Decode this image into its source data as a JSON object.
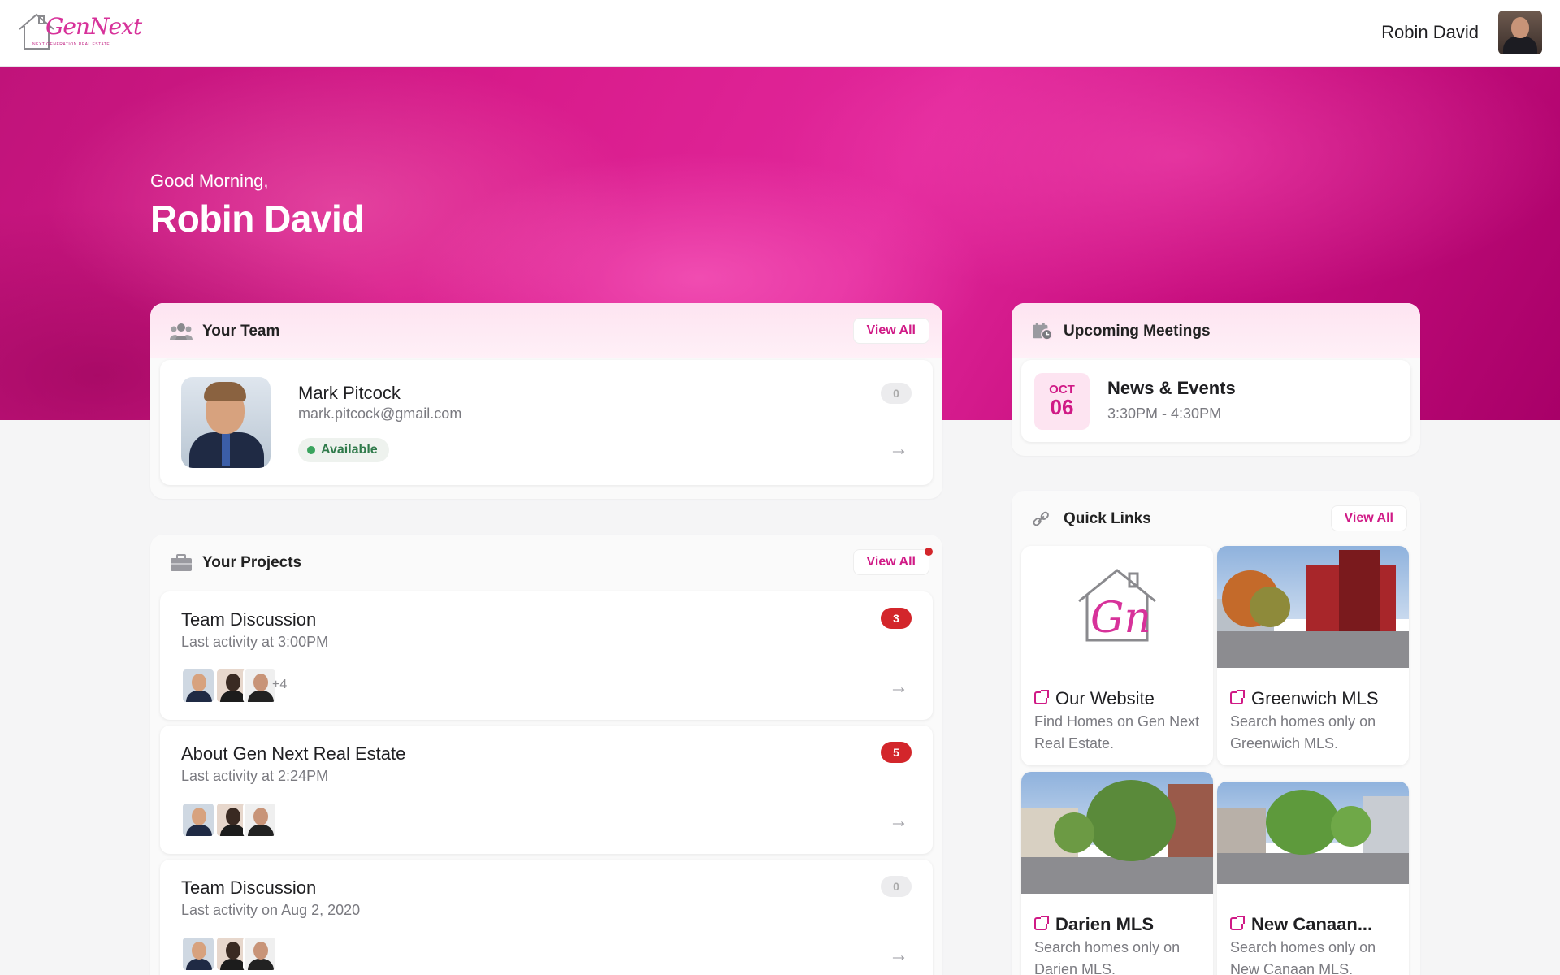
{
  "header": {
    "logo_text": "GenNext",
    "logo_tagline": "NEXT GENERATION REAL ESTATE",
    "user_name": "Robin David"
  },
  "hero": {
    "greeting": "Good Morning,",
    "name": "Robin David"
  },
  "team": {
    "title": "Your Team",
    "view_all": "View All",
    "icon": "people-icon",
    "member": {
      "name": "Mark Pitcock",
      "email": "mark.pitcock@gmail.com",
      "status": "Available",
      "count": "0"
    }
  },
  "projects": {
    "title": "Your Projects",
    "view_all": "View All",
    "icon": "briefcase-icon",
    "items": [
      {
        "title": "Team Discussion",
        "subtitle": "Last activity at 3:00PM",
        "count": "3",
        "extra": "+4"
      },
      {
        "title": "About Gen Next Real Estate",
        "subtitle": "Last activity at 2:24PM",
        "count": "5",
        "extra": ""
      },
      {
        "title": "Team Discussion",
        "subtitle": "Last activity on Aug 2, 2020",
        "count": "0",
        "extra": ""
      }
    ]
  },
  "meetings": {
    "title": "Upcoming Meetings",
    "icon": "calendar-clock-icon",
    "items": [
      {
        "month": "OCT",
        "day": "06",
        "title": "News & Events",
        "time": "3:30PM - 4:30PM"
      }
    ]
  },
  "quick_links": {
    "title": "Quick Links",
    "view_all": "View All",
    "icon": "link-icon",
    "items": [
      {
        "name": "Our Website",
        "description": "Find Homes on Gen Next Real Estate."
      },
      {
        "name": "Greenwich MLS",
        "description": "Search homes only on Greenwich MLS."
      },
      {
        "name": "Darien MLS",
        "description": "Search homes only on Darien MLS."
      },
      {
        "name": "New Canaan...",
        "description": "Search homes only on New Canaan MLS."
      }
    ]
  },
  "colors": {
    "accent": "#d01a86",
    "badge_red": "#d3262b",
    "available_green": "#3aa45e"
  }
}
